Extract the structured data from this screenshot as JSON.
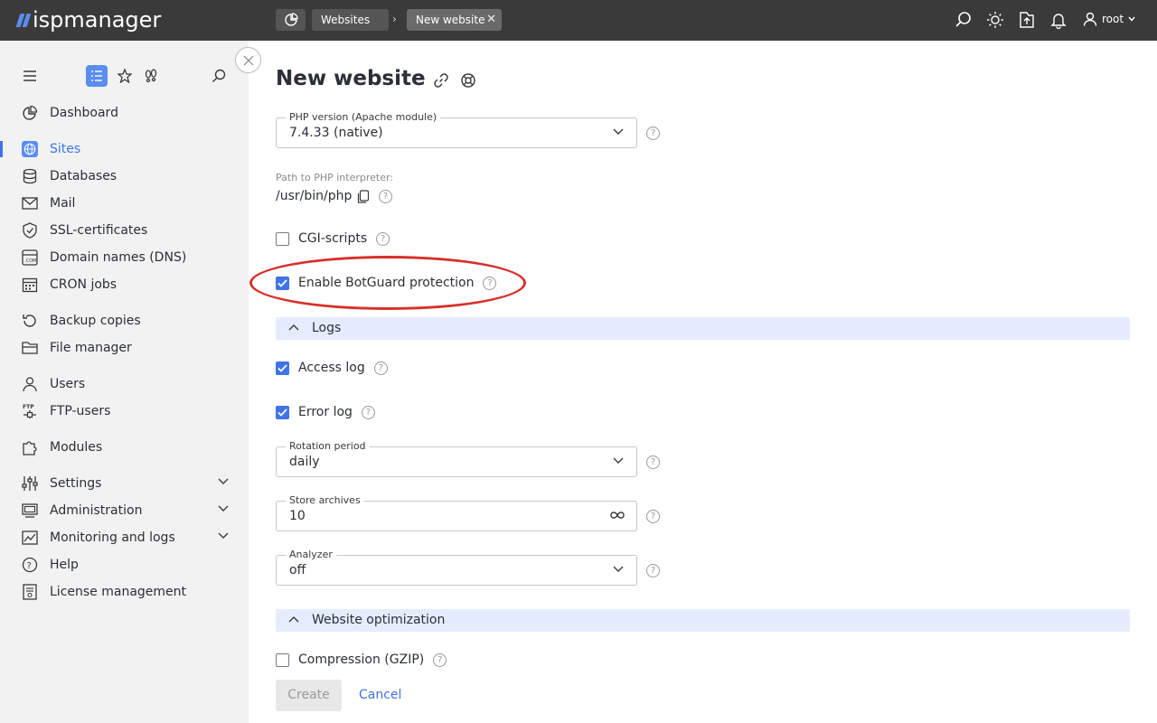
{
  "app": {
    "logo_text": "ispmanager"
  },
  "topbar": {
    "breadcrumb_parent": "Websites",
    "breadcrumb_current": "New website",
    "user_name": "root"
  },
  "sidebar": {
    "items": [
      {
        "label": "Dashboard",
        "icon": "dashboard-icon"
      },
      {
        "label": "Sites",
        "icon": "globe-icon",
        "active": true
      },
      {
        "label": "Databases",
        "icon": "database-icon"
      },
      {
        "label": "Mail",
        "icon": "mail-icon"
      },
      {
        "label": "SSL-certificates",
        "icon": "certificate-icon"
      },
      {
        "label": "Domain names (DNS)",
        "icon": "dns-icon"
      },
      {
        "label": "CRON jobs",
        "icon": "calendar-icon"
      },
      {
        "label": "Backup copies",
        "icon": "backup-icon"
      },
      {
        "label": "File manager",
        "icon": "folder-icon"
      },
      {
        "label": "Users",
        "icon": "user-icon"
      },
      {
        "label": "FTP-users",
        "icon": "ftp-icon"
      },
      {
        "label": "Modules",
        "icon": "puzzle-icon"
      },
      {
        "label": "Settings",
        "icon": "sliders-icon"
      },
      {
        "label": "Administration",
        "icon": "monitor-icon"
      },
      {
        "label": "Monitoring and logs",
        "icon": "chart-icon"
      },
      {
        "label": "Help",
        "icon": "help-icon"
      },
      {
        "label": "License management",
        "icon": "license-icon"
      }
    ]
  },
  "form": {
    "title": "New website",
    "php_version": {
      "label": "PHP version (Apache module)",
      "value": "7.4.33 (native)"
    },
    "php_path": {
      "label": "Path to PHP interpreter:",
      "value": "/usr/bin/php"
    },
    "cgi_scripts": {
      "label": "CGI-scripts",
      "checked": false
    },
    "botguard": {
      "label": "Enable BotGuard protection",
      "checked": true
    },
    "logs_section": "Logs",
    "access_log": {
      "label": "Access log",
      "checked": true
    },
    "error_log": {
      "label": "Error log",
      "checked": true
    },
    "rotation_period": {
      "label": "Rotation period",
      "value": "daily"
    },
    "store_archives": {
      "label": "Store archives",
      "value": "10"
    },
    "analyzer": {
      "label": "Analyzer",
      "value": "off"
    },
    "optimization_section": "Website optimization",
    "compression": {
      "label": "Compression (GZIP)",
      "checked": false
    },
    "create_label": "Create",
    "cancel_label": "Cancel"
  },
  "colors": {
    "accent": "#3f74e6",
    "topbar": "#3a3a3a",
    "sidebar": "#f2f2f2",
    "section": "#e5ecfd",
    "highlight": "#d8302b"
  }
}
